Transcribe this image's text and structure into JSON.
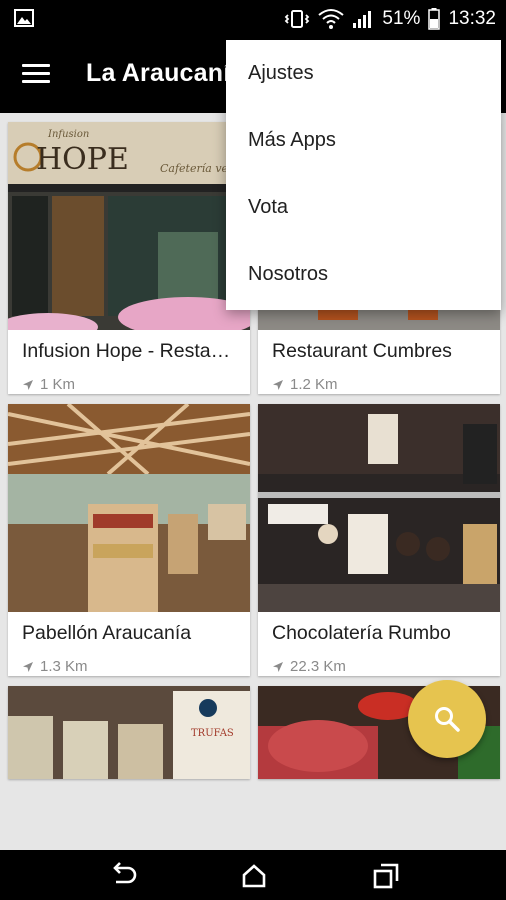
{
  "status_bar": {
    "battery": "51%",
    "time": "13:32"
  },
  "app_bar": {
    "title": "La Araucanía"
  },
  "overflow_menu": {
    "items": [
      "Ajustes",
      "Más Apps",
      "Vota",
      "Nosotros"
    ]
  },
  "places": [
    {
      "name": "Infusion Hope - Restaurante",
      "distance": "1 Km",
      "sign_text": "HOPE",
      "sign_small": "Infusion",
      "sign_cafe": "Cafetería veg"
    },
    {
      "name": "Restaurant Cumbres",
      "distance": "1.2 Km"
    },
    {
      "name": "Pabellón Araucanía",
      "distance": "1.3 Km"
    },
    {
      "name": "Chocolatería Rumbo",
      "distance": "22.3 Km"
    },
    {
      "name": "",
      "distance": "",
      "label_text": "TRUFAS"
    },
    {
      "name": "",
      "distance": ""
    }
  ],
  "colors": {
    "fab": "#e6c44f",
    "bar": "#000000",
    "background": "#e6e6e6"
  },
  "icons": {
    "fab": "search-icon",
    "menu": "hamburger-menu-icon"
  }
}
